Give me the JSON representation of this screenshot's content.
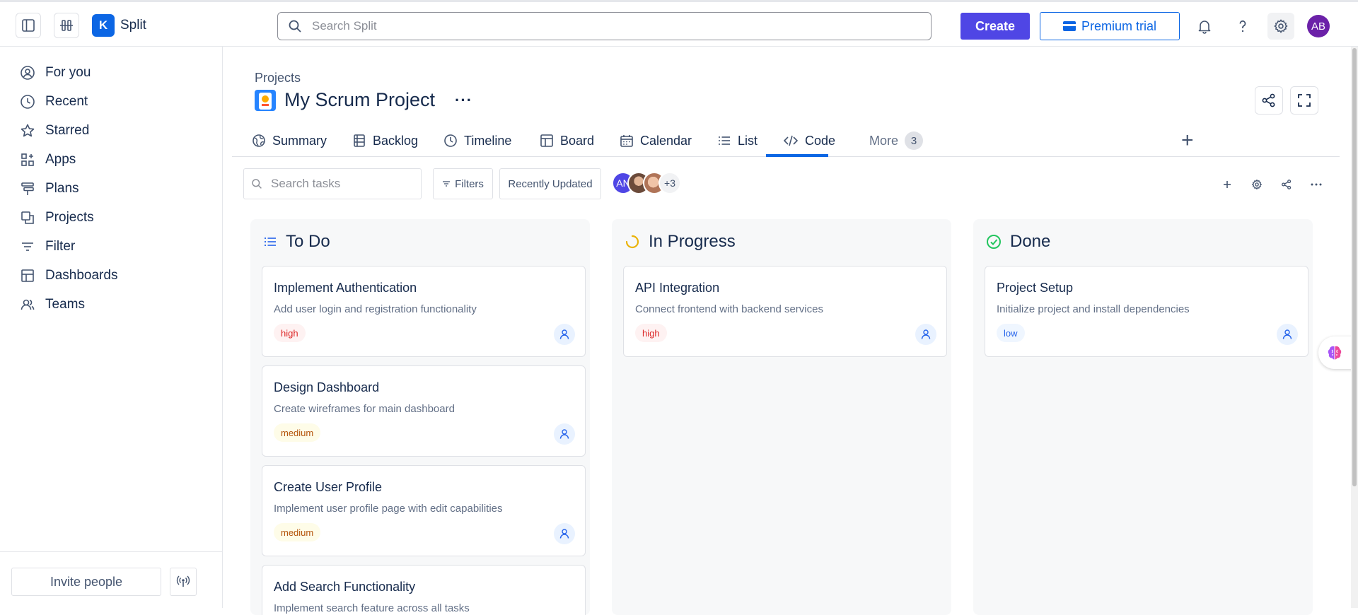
{
  "app": {
    "name": "Split",
    "logo_letter": "K"
  },
  "topbar": {
    "search_placeholder": "Search Split",
    "create_label": "Create",
    "premium_label": "Premium trial",
    "avatar_initials": "AB"
  },
  "sidebar": {
    "items": [
      {
        "label": "For you",
        "icon": "user-circle-icon"
      },
      {
        "label": "Recent",
        "icon": "clock-icon"
      },
      {
        "label": "Starred",
        "icon": "star-icon"
      },
      {
        "label": "Apps",
        "icon": "apps-icon"
      },
      {
        "label": "Plans",
        "icon": "plans-icon"
      },
      {
        "label": "Projects",
        "icon": "projects-icon"
      },
      {
        "label": "Filter",
        "icon": "filter-icon"
      },
      {
        "label": "Dashboards",
        "icon": "dashboard-icon"
      },
      {
        "label": "Teams",
        "icon": "teams-icon"
      }
    ],
    "invite_label": "Invite people"
  },
  "project": {
    "breadcrumb": "Projects",
    "title": "My Scrum Project"
  },
  "tabs": [
    {
      "label": "Summary",
      "icon": "globe-icon"
    },
    {
      "label": "Backlog",
      "icon": "backlog-icon"
    },
    {
      "label": "Timeline",
      "icon": "timeline-icon"
    },
    {
      "label": "Board",
      "icon": "board-icon",
      "active": true
    },
    {
      "label": "Calendar",
      "icon": "calendar-icon"
    },
    {
      "label": "List",
      "icon": "list-icon"
    },
    {
      "label": "Code",
      "icon": "code-icon"
    }
  ],
  "more_tab": {
    "label": "More",
    "count": "3"
  },
  "toolbar": {
    "search_placeholder": "Search tasks",
    "filters_label": "Filters",
    "sort_label": "Recently Updated",
    "avatar_initials": "AN",
    "extra_members": "+3"
  },
  "columns": [
    {
      "title": "To Do",
      "cards": [
        {
          "title": "Implement Authentication",
          "description": "Add user login and registration functionality",
          "priority": "high"
        },
        {
          "title": "Design Dashboard",
          "description": "Create wireframes for main dashboard",
          "priority": "medium"
        },
        {
          "title": "Create User Profile",
          "description": "Implement user profile page with edit capabilities",
          "priority": "medium"
        },
        {
          "title": "Add Search Functionality",
          "description": "Implement search feature across all tasks",
          "priority": ""
        }
      ]
    },
    {
      "title": "In Progress",
      "cards": [
        {
          "title": "API Integration",
          "description": "Connect frontend with backend services",
          "priority": "high"
        }
      ]
    },
    {
      "title": "Done",
      "cards": [
        {
          "title": "Project Setup",
          "description": "Initialize project and install dependencies",
          "priority": "low"
        }
      ]
    }
  ],
  "colors": {
    "accent": "#0c66e4",
    "create_button": "#4f46e5",
    "high": "#dc2626",
    "medium": "#b45309",
    "low": "#2563eb",
    "in_progress_ring": "#eab308",
    "done_check": "#22c55e"
  }
}
